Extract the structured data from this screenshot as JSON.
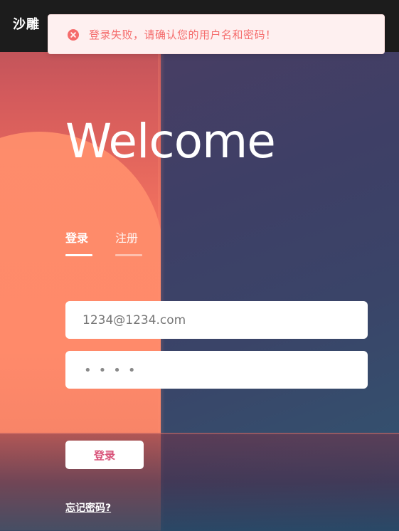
{
  "header": {
    "brand": "沙雕"
  },
  "toast": {
    "type": "error",
    "icon": "close-circle-icon",
    "message": "登录失败，请确认您的用户名和密码！"
  },
  "hero": {
    "title": "Welcome"
  },
  "tabs": [
    {
      "label": "登录",
      "active": true
    },
    {
      "label": "注册",
      "active": false
    }
  ],
  "form": {
    "email_value": "1234@1234.com",
    "password_mask": "••••",
    "submit_label": "登录"
  },
  "links": {
    "forgot_password": "忘记密码?"
  },
  "colors": {
    "topbar": "#1c1c1c",
    "toast_bg": "#fef0f0",
    "toast_text": "#f56c6c",
    "submit_text": "#d9537a",
    "bg_warm": "#ff8a6a",
    "bg_cool": "#3e3f66"
  }
}
